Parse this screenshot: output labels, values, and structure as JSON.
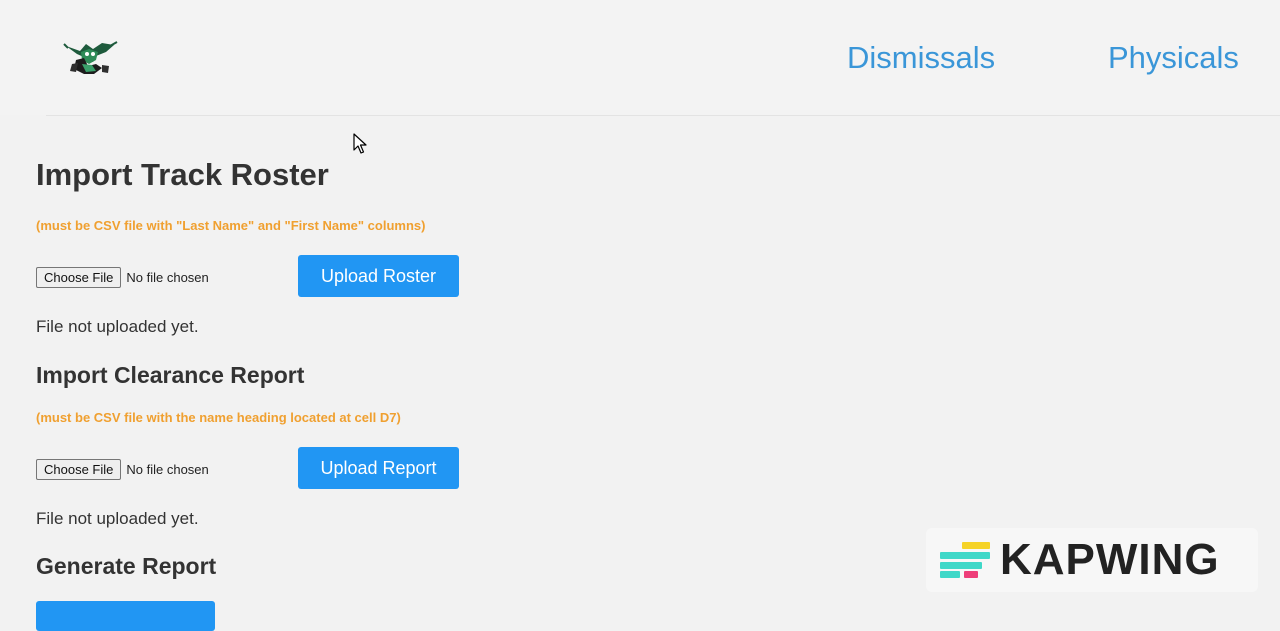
{
  "nav": {
    "dismissals": "Dismissals",
    "physicals": "Physicals"
  },
  "roster": {
    "title": "Import Track Roster",
    "note": "(must be CSV file with \"Last Name\" and \"First Name\" columns)",
    "choose_label": "Choose File",
    "file_status": "No file chosen",
    "upload_label": "Upload Roster",
    "upload_status": "File not uploaded yet."
  },
  "clearance": {
    "title": "Import Clearance Report",
    "note": "(must be CSV file with the name heading located at cell D7)",
    "choose_label": "Choose File",
    "file_status": "No file chosen",
    "upload_label": "Upload Report",
    "upload_status": "File not uploaded yet."
  },
  "generate": {
    "title": "Generate Report"
  },
  "watermark": {
    "text": "KAPWING"
  },
  "colors": {
    "accent": "#2196f3",
    "link": "#3a96d8",
    "note": "#f0a030"
  }
}
